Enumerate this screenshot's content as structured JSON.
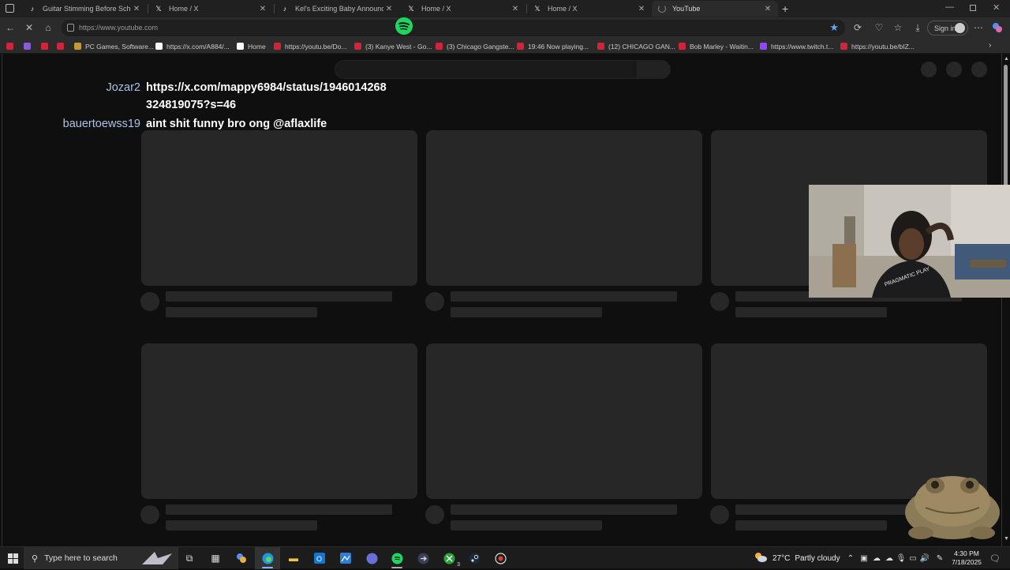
{
  "browser": {
    "tabs": [
      {
        "title": "Guitar Stimming Before School wi",
        "icon": "tiktok-icon",
        "active": false
      },
      {
        "title": "Home / X",
        "icon": "x-icon",
        "active": false
      },
      {
        "title": "Kel's Exciting Baby Announceme",
        "icon": "tiktok-icon",
        "active": false
      },
      {
        "title": "Home / X",
        "icon": "x-icon",
        "active": false
      },
      {
        "title": "Home / X",
        "icon": "x-icon",
        "active": false
      },
      {
        "title": "YouTube",
        "icon": "loading-icon",
        "active": true
      }
    ],
    "address": "https://www.youtube.com",
    "sign_in_label": "Sign in",
    "bookmarks": [
      {
        "title": "",
        "color": "#d0243a"
      },
      {
        "title": "",
        "color": "#8a5bd6"
      },
      {
        "title": "",
        "color": "#d0243a"
      },
      {
        "title": "",
        "color": "#d0243a"
      },
      {
        "title": "PC Games, Software...",
        "color": "#c29a3a"
      },
      {
        "title": "https://x.com/A884/...",
        "color": "#ffffff"
      },
      {
        "title": "Home",
        "color": "#ffffff"
      },
      {
        "title": "https://youtu.be/Do...",
        "color": "#d0243a"
      },
      {
        "title": "(3) Kanye West - Go...",
        "color": "#d0243a"
      },
      {
        "title": "(3) Chicago Gangste...",
        "color": "#d0243a"
      },
      {
        "title": "19:46 Now playing...",
        "color": "#d0243a"
      },
      {
        "title": "(12) CHICAGO GAN...",
        "color": "#d0243a"
      },
      {
        "title": "Bob Marley - Waitin...",
        "color": "#d0243a"
      },
      {
        "title": "https://www.twitch.t...",
        "color": "#9146ff"
      },
      {
        "title": "https://youtu.be/bIZ...",
        "color": "#d0243a"
      }
    ]
  },
  "chat": [
    {
      "user": "Jozar2",
      "message_line1": "https://x.com/mappy6984/status/1946014268",
      "message_line2": "324819075?s=46"
    },
    {
      "user": "bauertoewss19",
      "message_line1": "aint shit funny bro ong @aflaxlife",
      "message_line2": ""
    }
  ],
  "webcam": {
    "shirt_text": "PRAGMATIC PLAY"
  },
  "taskbar": {
    "search_placeholder": "Type here to search",
    "weather_temp": "27°C",
    "weather_desc": "Partly cloudy",
    "time": "4:30 PM",
    "date": "7/18/2025",
    "xbox_badge": "3"
  },
  "colors": {
    "accent": "#7fb8ff",
    "spotify_green": "#1ed760",
    "youtube_red": "#d0243a",
    "skeleton": "#272727"
  }
}
